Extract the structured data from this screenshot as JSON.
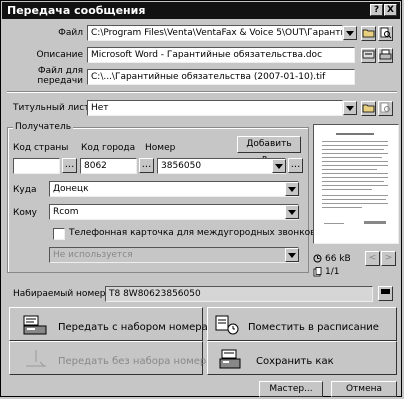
{
  "window": {
    "title": "Передача сообщения",
    "help": "?",
    "close": "X"
  },
  "file": {
    "label": "Файл",
    "value": "C:\\Program Files\\Venta\\VentaFax & Voice 5\\OUT\\Гарантийны"
  },
  "description": {
    "label": "Описание",
    "value": "Microsoft Word - Гарантийные обязательства.doc"
  },
  "transfer_file": {
    "label_line1": "Файл для",
    "label_line2": "передачи",
    "value": "C:\\...\\Гарантийные обязательства (2007-01-10).tif"
  },
  "cover": {
    "label": "Титульный лист",
    "value": "Нет"
  },
  "recipient": {
    "group_label": "Получатель",
    "country_label": "Код страны",
    "city_label": "Код города",
    "number_label": "Номер",
    "add_button": "Добавить в...",
    "country_value": "",
    "city_value": "8062",
    "number_value": "3856050",
    "to_label": "Куда",
    "to_value": "Донецк",
    "whom_label": "Кому",
    "whom_value": "Rcom",
    "phonecard_label": "Телефонная карточка для междугородных звонков",
    "phonecard_value": "Не используется",
    "ellipsis": "..."
  },
  "preview": {
    "size": "66 kB",
    "pages": "1/1",
    "prev": "<",
    "next": ">"
  },
  "dial": {
    "label": "Набираемый номер",
    "value": "T8 8W80623856050"
  },
  "actions": {
    "send_dial": "Передать с набором номера",
    "schedule": "Поместить в расписание",
    "send_nodial": "Передать без набора номера",
    "save_as": "Сохранить как"
  },
  "footer": {
    "master": "Мастер...",
    "cancel": "Отмена"
  }
}
